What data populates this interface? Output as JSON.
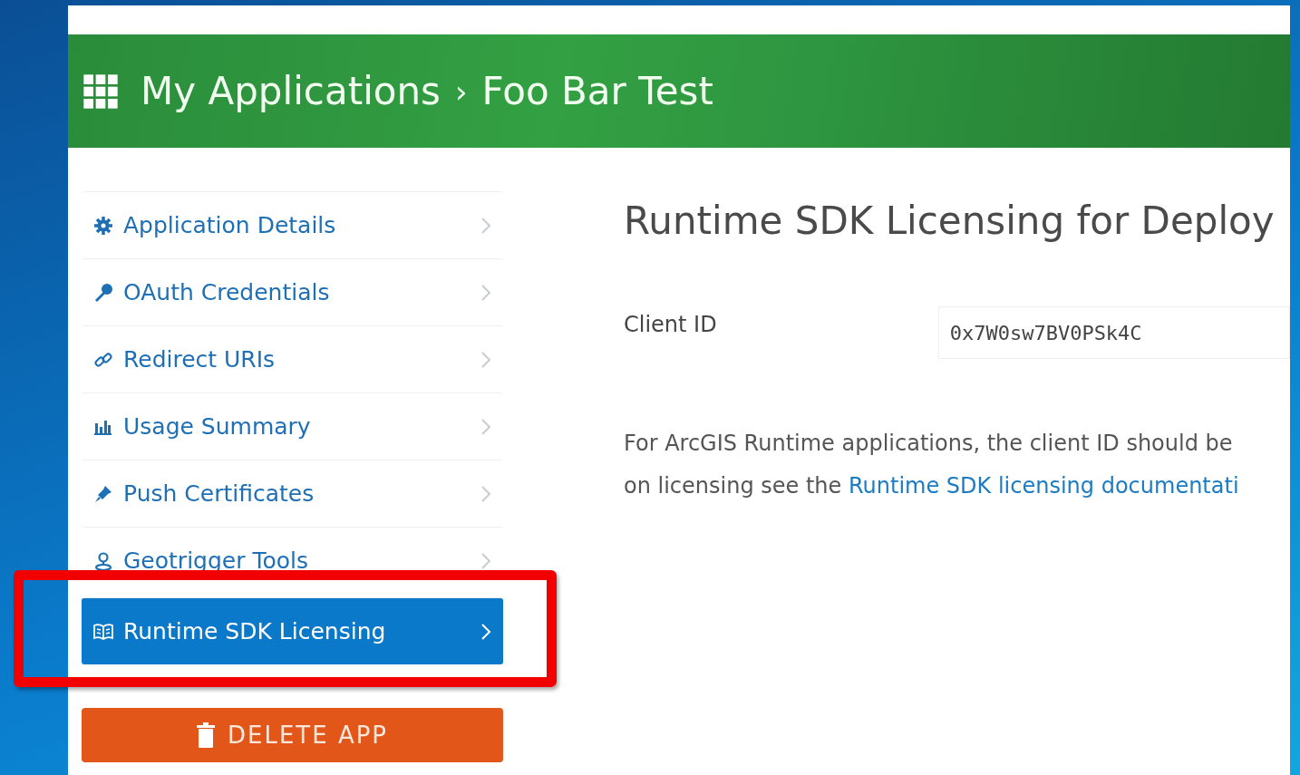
{
  "header": {
    "breadcrumb": [
      {
        "label": "My Applications"
      },
      {
        "label": "Foo Bar Test"
      }
    ],
    "separator": "›"
  },
  "sidebar": {
    "items": [
      {
        "label": "Application Details",
        "selected": false,
        "highlighted": false
      },
      {
        "label": "OAuth Credentials",
        "selected": false,
        "highlighted": false
      },
      {
        "label": "Redirect URIs",
        "selected": false,
        "highlighted": false
      },
      {
        "label": "Usage Summary",
        "selected": false,
        "highlighted": false
      },
      {
        "label": "Push Certificates",
        "selected": false,
        "highlighted": false
      },
      {
        "label": "Geotrigger Tools",
        "selected": false,
        "highlighted": false
      },
      {
        "label": "Runtime SDK Licensing",
        "selected": true,
        "highlighted": true
      }
    ],
    "delete_button": "DELETE APP"
  },
  "content": {
    "title": "Runtime SDK Licensing for Deploy",
    "client_id": {
      "label": "Client ID",
      "value": "0x7W0sw7BV0PSk4C"
    },
    "paragraph": {
      "line1": "For ArcGIS Runtime applications, the client ID should be",
      "line2": "on licensing see the",
      "link": "Runtime SDK licensing documentati"
    }
  }
}
